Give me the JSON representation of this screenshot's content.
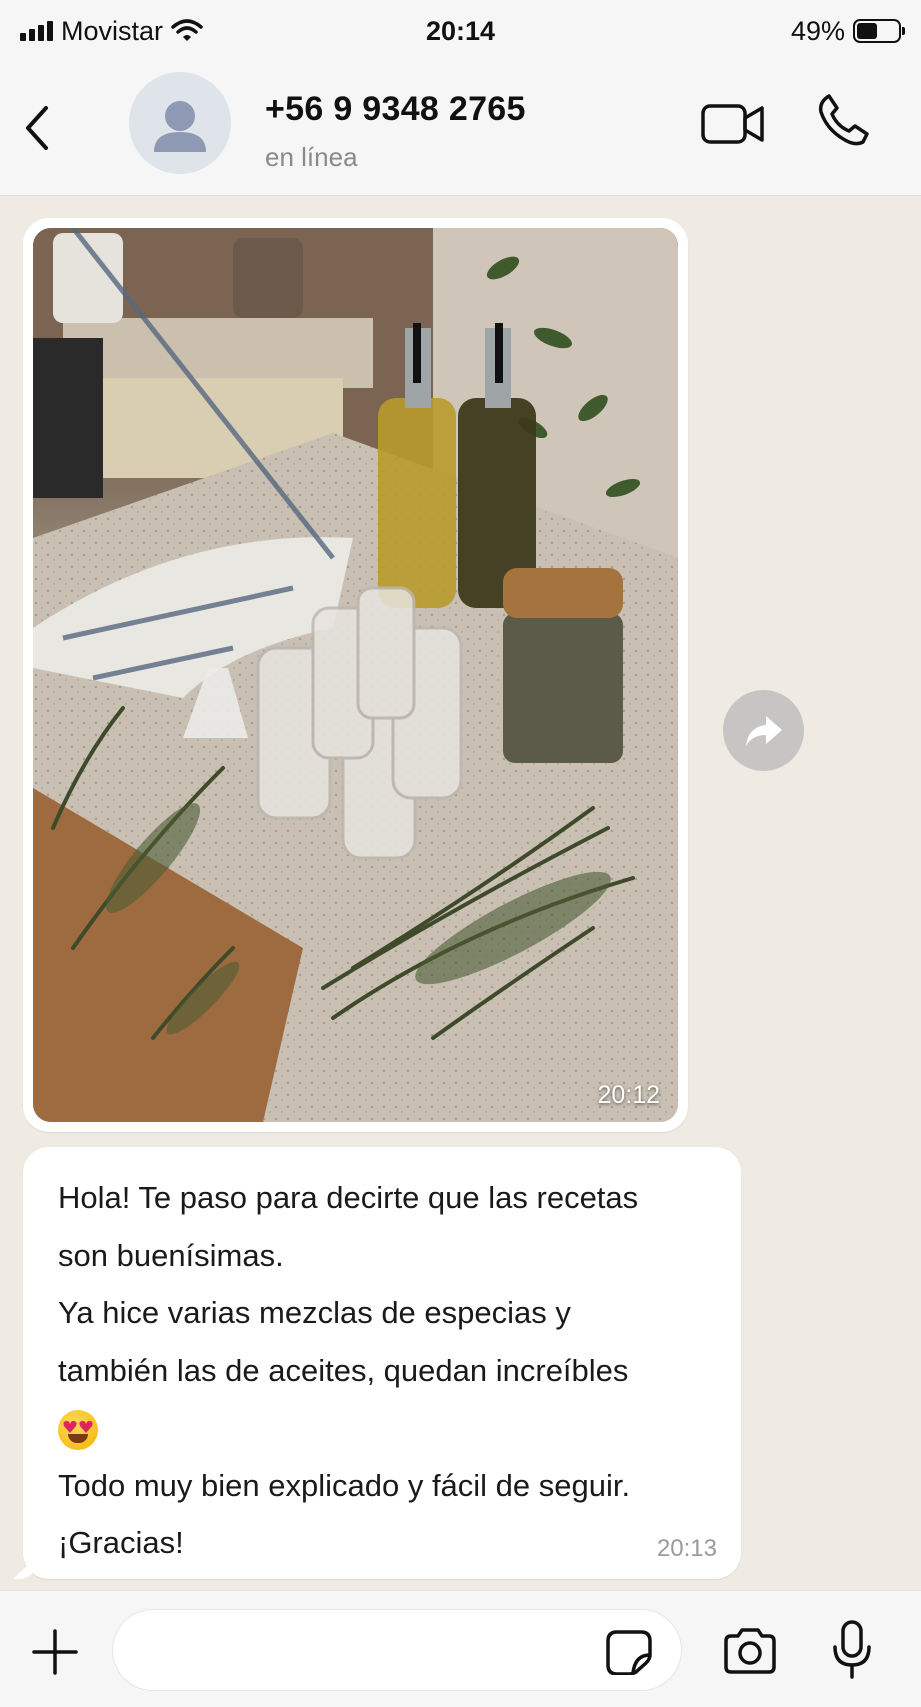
{
  "status_bar": {
    "carrier": "Movistar",
    "time": "20:14",
    "battery_percent": "49%",
    "battery_level": 0.49,
    "icons": [
      "cellular-signal-icon",
      "wifi-icon",
      "battery-icon"
    ]
  },
  "header": {
    "contact_name": "+56 9 9348 2765",
    "contact_status": "en línea",
    "icons": [
      "chevron-left-icon",
      "default-avatar-icon",
      "video-camera-icon",
      "phone-icon"
    ]
  },
  "messages": [
    {
      "type": "image",
      "time": "20:12",
      "icon": "forward-icon"
    },
    {
      "type": "text",
      "lines": [
        "Hola! Te paso para decirte que las recetas",
        "son buenísimas.",
        "Ya hice varias mezclas de especias y",
        "también las de aceites, quedan increíbles",
        "Todo muy bien explicado y fácil de seguir.",
        "¡Gracias!"
      ],
      "emoji": "heart-eyes-emoji",
      "time": "20:13"
    }
  ],
  "input_bar": {
    "placeholder": "",
    "icons": [
      "plus-icon",
      "sticker-icon",
      "camera-icon",
      "microphone-icon"
    ]
  },
  "colors": {
    "chat_background": "#efeae2",
    "bar_background": "#f6f6f6",
    "bubble": "#ffffff",
    "secondary_text": "#8a8a8a"
  }
}
